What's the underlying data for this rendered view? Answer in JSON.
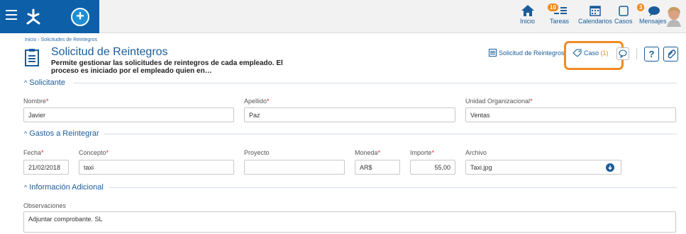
{
  "topbar": {
    "nav": [
      {
        "id": "inicio",
        "label": "Inicio",
        "icon": "home-icon"
      },
      {
        "id": "tareas",
        "label": "Tareas",
        "icon": "tasks-icon",
        "badge": "10"
      },
      {
        "id": "calendarios",
        "label": "Calendarios",
        "icon": "calendar-icon"
      },
      {
        "id": "casos",
        "label": "Casos",
        "icon": "cases-icon"
      },
      {
        "id": "mensajes",
        "label": "Mensajes",
        "icon": "messages-icon",
        "badge": "3"
      }
    ],
    "add_label": "+"
  },
  "breadcrumb": {
    "home": "Inicio",
    "sep": "›",
    "current": "Solicitudes de Reintegros"
  },
  "page": {
    "title": "Solicitud de Reintegros",
    "description": "Permite gestionar las solicitudes de reintegros de cada empleado. El proceso es iniciado por el empleado quien en…"
  },
  "header_actions": {
    "process_link": "Solicitud de Reintegros",
    "case_label": "Caso",
    "case_count": "(1)",
    "help_label": "?"
  },
  "sections": {
    "solicitante": "Solicitante",
    "gastos": "Gastos a Reintegrar",
    "info": "Información Adicional"
  },
  "required_mark": "*",
  "solicitante": {
    "nombre": {
      "label": "Nombre",
      "value": "Javier"
    },
    "apellido": {
      "label": "Apellido",
      "value": "Paz"
    },
    "unidad": {
      "label": "Unidad Organizacional",
      "value": "Ventas"
    }
  },
  "gastos": {
    "fecha": {
      "label": "Fecha",
      "value": "21/02/2018"
    },
    "concepto": {
      "label": "Concepto",
      "value": "taxi"
    },
    "proyecto": {
      "label": "Proyecto",
      "value": ""
    },
    "moneda": {
      "label": "Moneda",
      "value": "AR$"
    },
    "importe": {
      "label": "Importe",
      "value": "55,00"
    },
    "archivo": {
      "label": "Archivo",
      "value": "Taxi.jpg"
    }
  },
  "info": {
    "observaciones": {
      "label": "Observaciones",
      "value": "Adjuntar comprobante. SL"
    }
  },
  "colors": {
    "brand": "#0d5fa8",
    "accent": "#1a5c99",
    "highlight": "#f28a24",
    "required": "#d9232d"
  }
}
